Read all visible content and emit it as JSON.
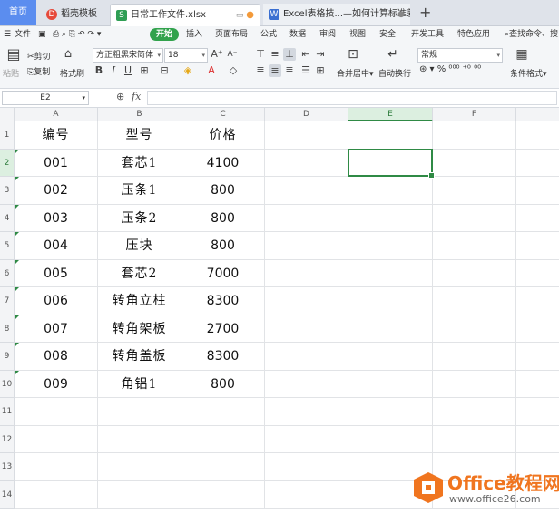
{
  "tabs": {
    "home": "首页",
    "daoke": "稻壳模板",
    "file": "日常工作文件.xlsx",
    "excel": "Excel表格技...—如何计算标准差"
  },
  "menu": {
    "file": "文件",
    "items": [
      "开始",
      "插入",
      "页面布局",
      "公式",
      "数据",
      "审阅",
      "视图",
      "安全",
      "开发工具",
      "特色应用"
    ],
    "search": "查找命令、搜"
  },
  "toolbar": {
    "paste": "粘贴",
    "cut": "剪切",
    "copy": "复制",
    "format_painter": "格式刷",
    "font_name": "方正粗黑宋简体",
    "font_size": "18",
    "merge_center": "合并居中",
    "wrap_text": "自动换行",
    "number_format": "常规",
    "conditional_format": "条件格式"
  },
  "formula_bar": {
    "name_box": "E2",
    "fx": "fx",
    "value": ""
  },
  "sheet": {
    "columns": [
      "A",
      "B",
      "C",
      "D",
      "E",
      "F"
    ],
    "selected_column": "E",
    "selected_row": "2",
    "rows": [
      {
        "n": "1",
        "a": "编号",
        "b": "型号",
        "c": "价格"
      },
      {
        "n": "2",
        "a": "001",
        "b": "套芯1",
        "c": "4100"
      },
      {
        "n": "3",
        "a": "002",
        "b": "压条1",
        "c": "800"
      },
      {
        "n": "4",
        "a": "003",
        "b": "压条2",
        "c": "800"
      },
      {
        "n": "5",
        "a": "004",
        "b": "压块",
        "c": "800"
      },
      {
        "n": "6",
        "a": "005",
        "b": "套芯2",
        "c": "7000"
      },
      {
        "n": "7",
        "a": "006",
        "b": "转角立柱",
        "c": "8300"
      },
      {
        "n": "8",
        "a": "007",
        "b": "转角架板",
        "c": "2700"
      },
      {
        "n": "9",
        "a": "008",
        "b": "转角盖板",
        "c": "8300"
      },
      {
        "n": "10",
        "a": "009",
        "b": "角铝1",
        "c": "800"
      },
      {
        "n": "11",
        "a": "",
        "b": "",
        "c": ""
      },
      {
        "n": "12",
        "a": "",
        "b": "",
        "c": ""
      },
      {
        "n": "13",
        "a": "",
        "b": "",
        "c": ""
      },
      {
        "n": "14",
        "a": "",
        "b": "",
        "c": ""
      }
    ]
  },
  "watermark": {
    "title": "Office教程网",
    "url": "www.office26.com"
  },
  "colors": {
    "accent_green": "#2f8a45",
    "home_tab_blue": "#5b8def",
    "watermark_orange": "#f0751f"
  }
}
